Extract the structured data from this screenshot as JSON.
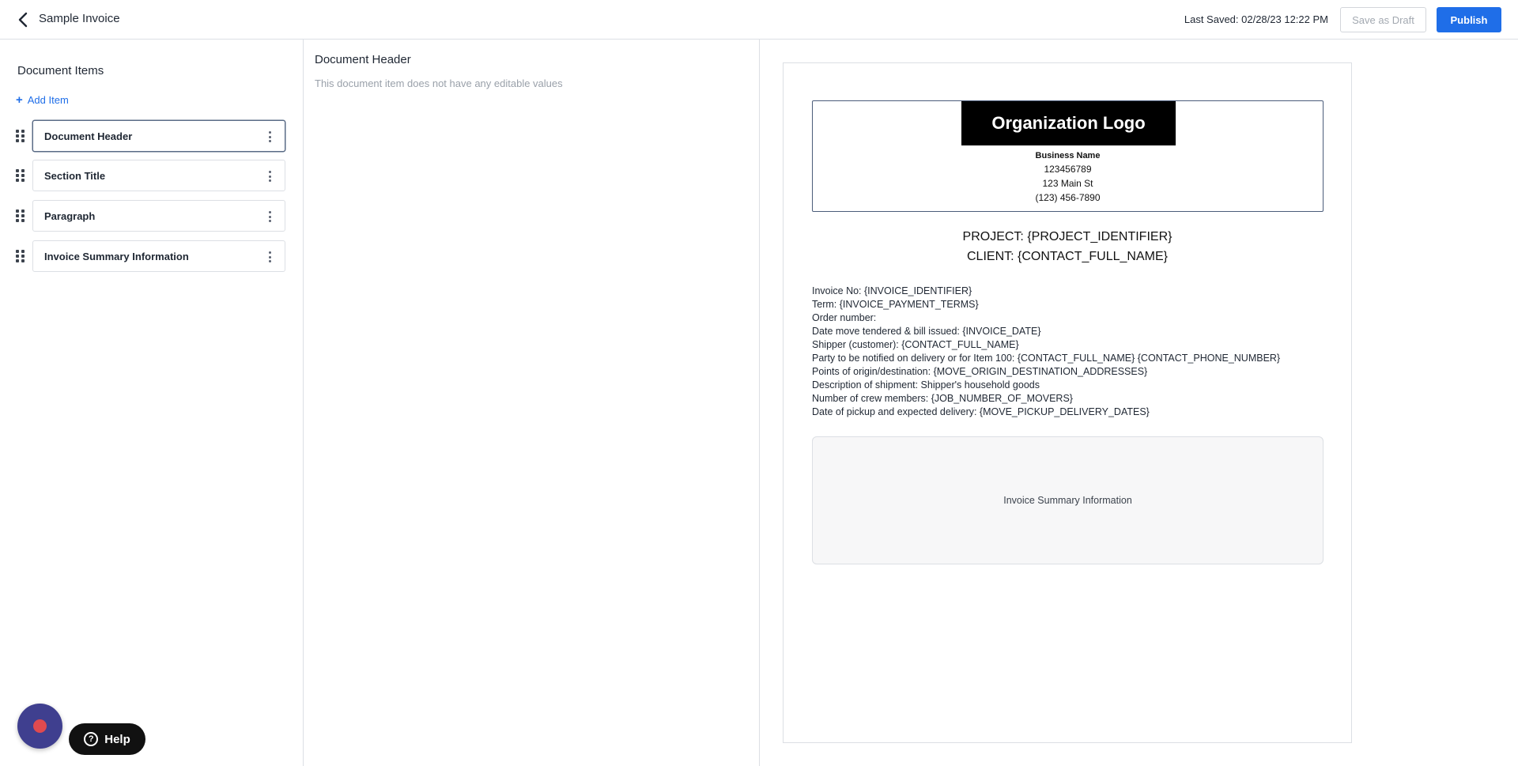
{
  "header": {
    "title": "Sample Invoice",
    "last_saved": "Last Saved: 02/28/23 12:22 PM",
    "save_draft_label": "Save as Draft",
    "publish_label": "Publish"
  },
  "sidebar": {
    "title": "Document Items",
    "add_item_label": "Add Item",
    "items": [
      {
        "label": "Document Header",
        "selected": true
      },
      {
        "label": "Section Title",
        "selected": false
      },
      {
        "label": "Paragraph",
        "selected": false
      },
      {
        "label": "Invoice Summary Information",
        "selected": false
      }
    ]
  },
  "editor": {
    "title": "Document Header",
    "note": "This document item does not have any editable values"
  },
  "preview": {
    "logo_text": "Organization Logo",
    "business_name": "Business Name",
    "business_lines": [
      "123456789",
      "123 Main St",
      "(123) 456-7890"
    ],
    "project_line": "PROJECT: {PROJECT_IDENTIFIER}",
    "client_line": "CLIENT: {CONTACT_FULL_NAME}",
    "info_lines": [
      "Invoice No: {INVOICE_IDENTIFIER}",
      "Term: {INVOICE_PAYMENT_TERMS}",
      "Order number:",
      "Date move tendered & bill issued: {INVOICE_DATE}",
      "Shipper (customer): {CONTACT_FULL_NAME}",
      "Party to be notified on delivery or for Item 100: {CONTACT_FULL_NAME} {CONTACT_PHONE_NUMBER}",
      "Points of origin/destination: {MOVE_ORIGIN_DESTINATION_ADDRESSES}",
      "Description of shipment: Shipper's household goods",
      "Number of crew members: {JOB_NUMBER_OF_MOVERS}",
      "Date of pickup and expected delivery: {MOVE_PICKUP_DELIVERY_DATES}"
    ],
    "summary_label": "Invoice Summary Information"
  },
  "widgets": {
    "help_label": "Help"
  },
  "colors": {
    "accent": "#1f6ee8",
    "record_button": "#3f3f8f",
    "record_dot": "#e04a4f"
  }
}
